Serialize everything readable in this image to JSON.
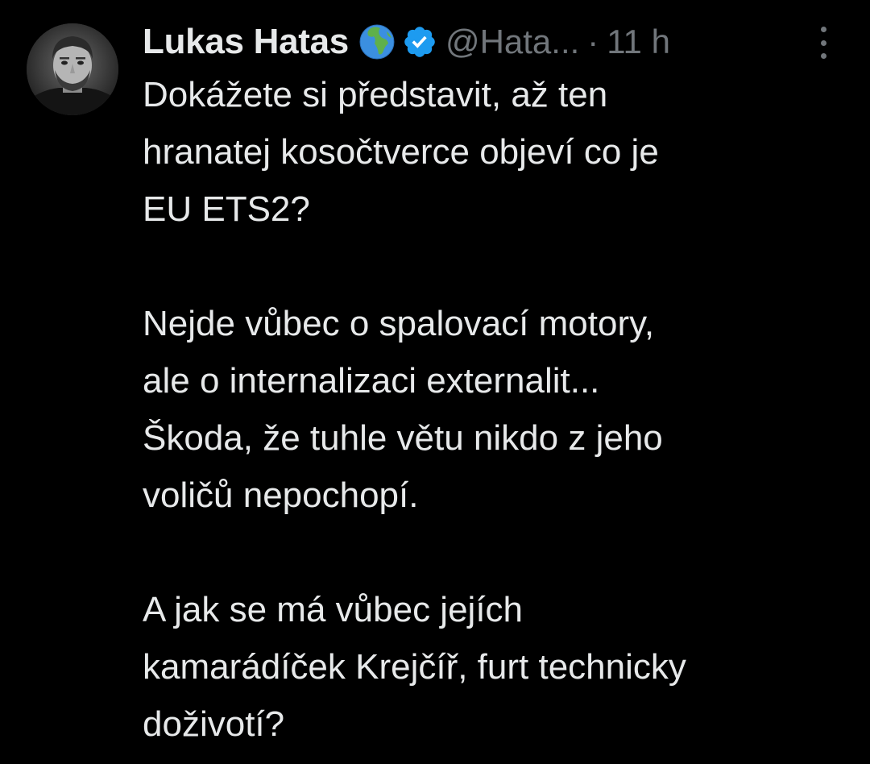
{
  "tweet": {
    "author": {
      "display_name": "Lukas Hatas",
      "emoji_icon": "globe-europe-africa-icon",
      "verified_icon": "verified-badge-icon",
      "verified_color": "#1d9bf0",
      "handle": "@Hata..."
    },
    "separator": "·",
    "time": "11 h",
    "more_icon": "more-options-icon",
    "paragraphs": [
      {
        "lines": [
          "Dokážete si představit, až ten",
          "hranatej kosočtverce objeví co je",
          "EU ETS2?"
        ]
      },
      {
        "lines": [
          "Nejde vůbec o spalovací motory,",
          "ale o internalizaci externalit...",
          "Škoda, že tuhle větu nikdo z jeho",
          "voličů nepochopí."
        ]
      },
      {
        "lines": [
          "A jak se má vůbec jejích",
          "kamarádíček Krejčíř, furt technicky",
          "doživotí?"
        ]
      }
    ]
  },
  "colors": {
    "background": "#000000",
    "primary_text": "#e7e9ea",
    "secondary_text": "#71767b",
    "accent": "#1d9bf0"
  }
}
